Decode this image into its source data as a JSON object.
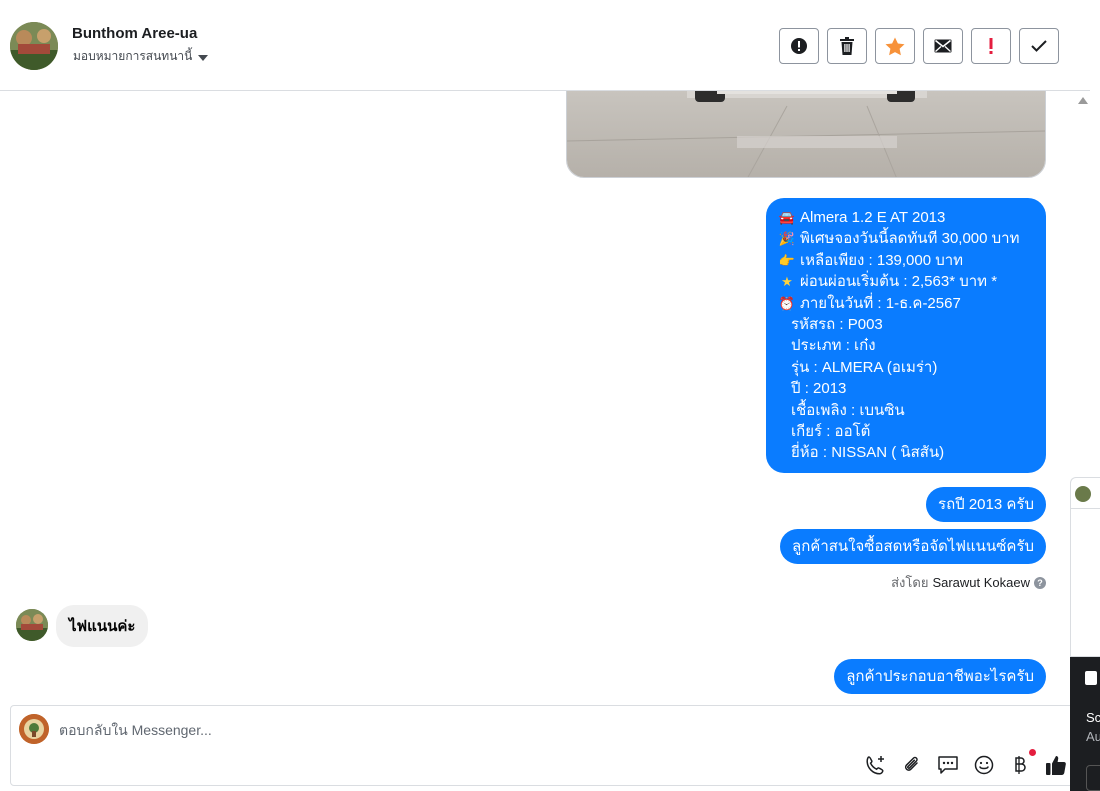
{
  "header": {
    "contact_name": "Bunthom Aree-ua",
    "assign_label": "มอบหมายการสนทนานี้"
  },
  "toolbar": {
    "buttons": [
      "alert-icon",
      "trash-icon",
      "star-icon",
      "envelope-icon",
      "exclamation-icon",
      "check-icon"
    ],
    "star_color": "#f7923a",
    "exclamation_color": "#e41e3f"
  },
  "messages": {
    "details": {
      "lines": [
        "Almera 1.2 E AT 2013",
        "พิเศษจองวันนี้ลดทันที 30,000 บาท",
        "เหลือเพียง : 139,000 บาท",
        "ผ่อนผ่อนเริ่มต้น : 2,563* บาท *",
        "ภายในวันที่ : 1-ธ.ค-2567",
        "รหัสรถ : P003",
        "ประเภท : เก๋ง",
        "รุ่น : ALMERA (อเมร่า)",
        "ปี : 2013",
        "เชื้อเพลิง : เบนซิน",
        "เกียร์ : ออโต้",
        "ยี่ห้อ : NISSAN ( นิสสัน)"
      ]
    },
    "year_reply": "รถปี 2013 ครับ",
    "finance_question": "ลูกค้าสนใจซื้อสดหรือจัดไฟแนนซ์ครับ",
    "sent_by_prefix": "ส่งโดย",
    "sent_by_name": "Sarawut Kokaew",
    "customer_reply": "ไฟแนนค่ะ",
    "occupation_question": "ลูกค้าประกอบอาชีพอะไรครับ"
  },
  "composer": {
    "placeholder": "ตอบกลับใน Messenger..."
  },
  "side_panel": {
    "line1": "Sc",
    "line2": "Au"
  },
  "colors": {
    "outgoing_bubble": "#0a7cff",
    "incoming_bubble": "#f0f0f0",
    "like_icon": "#1c1e21"
  }
}
